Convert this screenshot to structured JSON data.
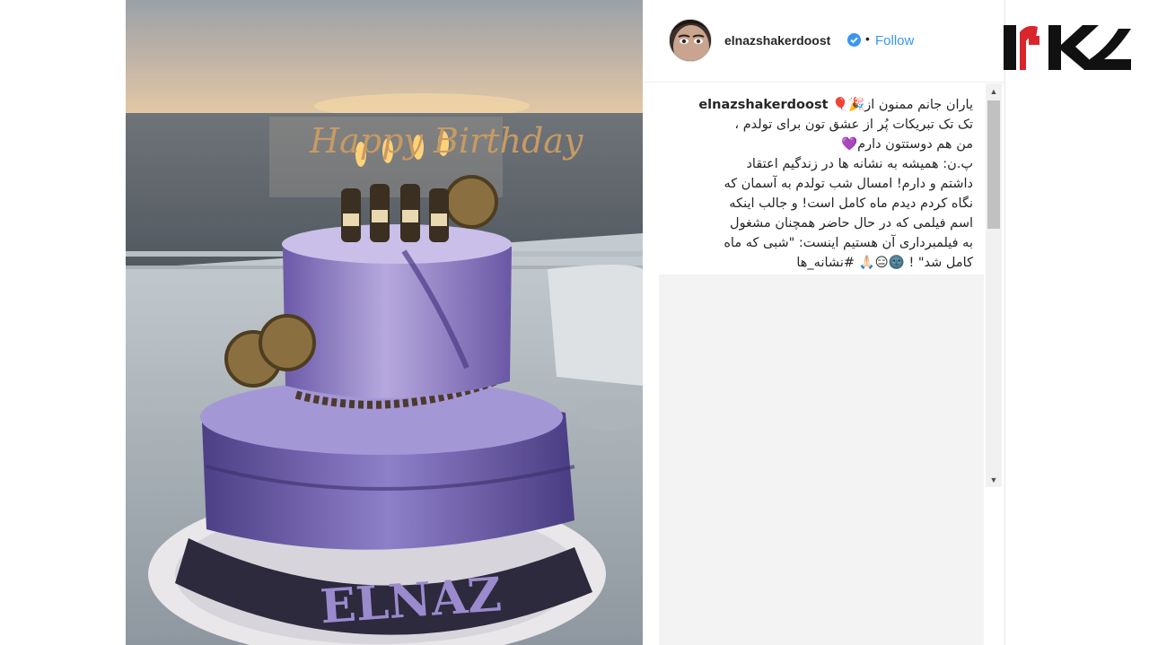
{
  "post": {
    "username": "elnazshakerdoost",
    "separator": "•",
    "follow_label": "Follow",
    "caption_user": "elnazshakerdoost",
    "caption_lines": [
      "یاران جانم ممنون از🎉🎈",
      "تک تک تبریکات پُر از عشق تون برای تولدم ،",
      "من هم دوستتون دارم💜",
      "پ.ن: همیشه به نشانه ها در زندگیم اعتقاد",
      "داشتم و دارم! امسال شب تولدم به آسمان که",
      "نگاه کردم دیدم ماه کامل است! و جالب اینکه",
      "اسم فیلمی که در حال حاضر همچنان مشغول",
      "به فیلمبرداری آن هستیم اینست: \"شبی که ماه",
      "کامل شد\" ! 🌚😑🙏🏻 #نشانه_ها"
    ]
  },
  "photo": {
    "cake_topper": "Happy Birthday",
    "cake_name": "ELNAZ"
  },
  "scrollbar": {
    "up_arrow": "▲",
    "down_arrow": "▼"
  },
  "colors": {
    "brand_red": "#d8262c",
    "brand_black": "#111111",
    "link_blue": "#3897f0",
    "cake_purple": "#7a63b8"
  },
  "icons": {
    "verified": "verified-badge-icon",
    "logo": "rokna-logo"
  }
}
